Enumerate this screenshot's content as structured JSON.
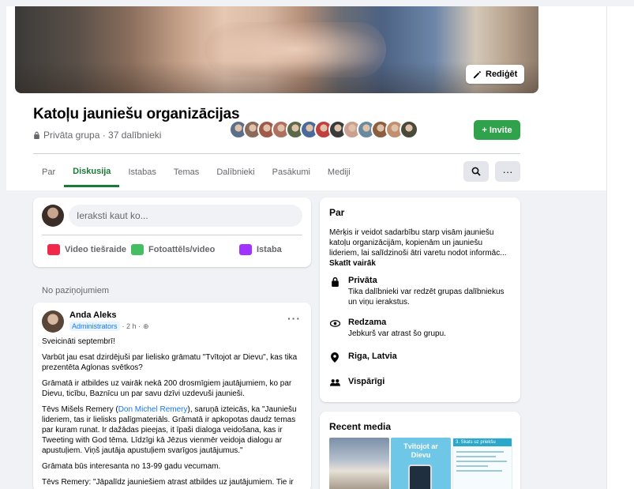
{
  "cover": {
    "edit_label": "Rediģēt"
  },
  "group": {
    "name": "Katoļu jauniešu organizācijas",
    "privacy_members": "Privāta grupa · 37 dalībnieki",
    "invite_label": "+ Invite",
    "member_avatar_colors": [
      "#5b6f8a",
      "#8a6a5a",
      "#a05a4a",
      "#b07060",
      "#5a6a4a",
      "#4a6a9a",
      "#c04040",
      "#3a3a3a",
      "#caa090",
      "#6a8aa0",
      "#8a6040",
      "#c09070",
      "#4a4a3a"
    ]
  },
  "tabs": [
    {
      "label": "Par",
      "active": false
    },
    {
      "label": "Diskusija",
      "active": true
    },
    {
      "label": "Istabas",
      "active": false
    },
    {
      "label": "Temas",
      "active": false
    },
    {
      "label": "Dalībnieki",
      "active": false
    },
    {
      "label": "Pasākumi",
      "active": false
    },
    {
      "label": "Mediji",
      "active": false
    }
  ],
  "composer": {
    "placeholder": "Ieraksti kaut ko...",
    "actions": [
      {
        "label": "Video tiešraide",
        "icon": "live-video-icon",
        "color": "#f02849"
      },
      {
        "label": "Fotoattēls/video",
        "icon": "photo-icon",
        "color": "#45bd62"
      },
      {
        "label": "Istaba",
        "icon": "room-icon",
        "color": "#a033ff"
      }
    ]
  },
  "feed": {
    "section_label": "No paziņojumiem",
    "post": {
      "author": "Anda Aleks",
      "role": "Administrators",
      "time": "· 2 h ·",
      "paragraphs": [
        "Sveicināti septembrī!",
        "Varbūt jau esat dzirdējuši par lielisko grāmatu \"Tvītojot ar Dievu\", kas tika prezentēta Aglonas svētkos?",
        "Grāmatā ir atbildes uz vairāk nekā 200 drosmīgiem jautājumiem, ko par Dievu, ticību, Baznīcu un par savu dzīvi uzdevuši jaunieši.",
        "Grāmata būs interesanta no 13-99 gadu vecumam.",
        "Tēvs Remery: \"Jāpalīdz jauniešiem atrast atbildes uz jautājumiem. Tie ir"
      ],
      "para4_before": "Tēvs Mišels Remery (",
      "para4_link": "Don Michel Remery",
      "para4_after": "), saruņā izteicās, ka \"Jauniešu lideriem, tas ir lielisks palīgmateriāls. Grāmatā ir apkopotas daudz temas par kuram runat. Ir dažādas pieejas, it īpaši dialoga veidošana, kas ir Tweeting with God tēma. Līdzīgi kā Jēzus vienmēr veidoja dialogu ar apustuļiem. Viņš jautāja apustuļiem svarīgos jautājumus.\""
    }
  },
  "about": {
    "heading": "Par",
    "description": "Mērķis ir veidot sadarbību starp visām jauniešu katoļu organizācijām, kopienām un jauniešu lideriem, lai salīdzinoši ātri varetu nodot informāc...",
    "see_more": "Skatīt vairāk",
    "private_title": "Privāta",
    "private_text": "Tika dalībnieki var redzēt grupas dalībniekus un viņu ierakstus.",
    "visible_title": "Redzama",
    "visible_text": "Jebkurš var atrast šo grupu.",
    "location": "Riga, Latvia",
    "general": "Vispārīgi"
  },
  "media": {
    "heading": "Recent media",
    "thumb2_title": "Tvītojot ar Dievu",
    "thumb3_title": "3. Skats uz priekšu"
  }
}
